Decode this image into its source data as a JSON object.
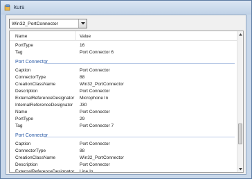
{
  "window": {
    "title": "kurs"
  },
  "combo": {
    "selected": "Win32_PortConnector"
  },
  "grid": {
    "columns": {
      "name": "Name",
      "value": "Value"
    },
    "rows": [
      {
        "type": "prop",
        "name": "PortType",
        "value": "16"
      },
      {
        "type": "prop",
        "name": "Tag",
        "value": "Port Connector 6"
      },
      {
        "type": "spacer"
      },
      {
        "type": "group",
        "label": "Port Connector"
      },
      {
        "type": "prop",
        "name": "Caption",
        "value": "Port Connector"
      },
      {
        "type": "prop",
        "name": "ConnectorType",
        "value": "88"
      },
      {
        "type": "prop",
        "name": "CreationClassName",
        "value": "Win32_PortConnector"
      },
      {
        "type": "prop",
        "name": "Description",
        "value": "Port Connector"
      },
      {
        "type": "prop",
        "name": "ExternalReferenceDesignator",
        "value": "Microphone In"
      },
      {
        "type": "prop",
        "name": "InternalReferenceDesignator",
        "value": "J30"
      },
      {
        "type": "prop",
        "name": "Name",
        "value": "Port Connector"
      },
      {
        "type": "prop",
        "name": "PortType",
        "value": "29"
      },
      {
        "type": "prop",
        "name": "Tag",
        "value": "Port Connector 7"
      },
      {
        "type": "spacer"
      },
      {
        "type": "group",
        "label": "Port Connector"
      },
      {
        "type": "prop",
        "name": "Caption",
        "value": "Port Connector"
      },
      {
        "type": "prop",
        "name": "ConnectorType",
        "value": "88"
      },
      {
        "type": "prop",
        "name": "CreationClassName",
        "value": "Win32_PortConnector"
      },
      {
        "type": "prop",
        "name": "Description",
        "value": "Port Connector"
      },
      {
        "type": "prop",
        "name": "ExternalReferenceDesignator",
        "value": "Line In"
      }
    ]
  },
  "scrollbar": {
    "position": 0.8
  },
  "icons": {
    "app": "app-icon",
    "dropdown": "chevron-down-icon",
    "scroll_up": "arrow-up-icon",
    "scroll_down": "arrow-down-icon"
  },
  "colors": {
    "group_text": "#2a5aa6",
    "window_frame": "#c9d8ea"
  }
}
